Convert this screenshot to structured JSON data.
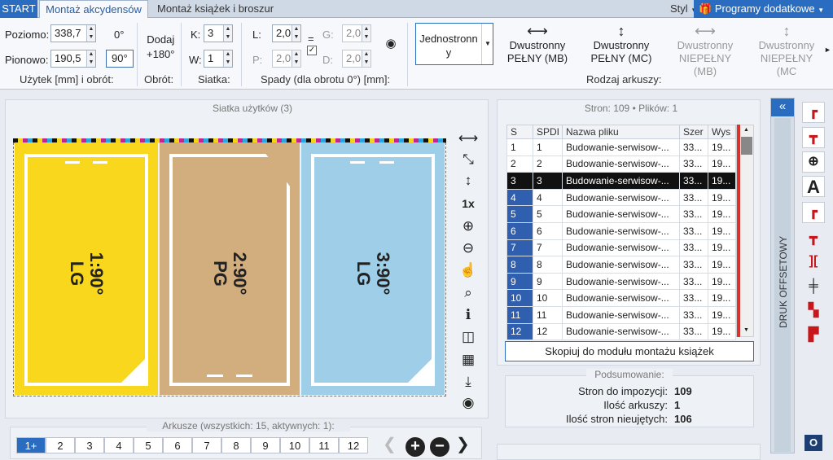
{
  "tabs": {
    "start": "START",
    "active": "Montaż akcydensów",
    "books": "Montaż książek i broszur",
    "style": "Styl",
    "addons": "Programy dodatkowe"
  },
  "ribbon": {
    "horizontal_label": "Poziomo:",
    "horizontal_value": "338,7",
    "vertical_label": "Pionowo:",
    "vertical_value": "190,5",
    "rot0": "0°",
    "rot90": "90°",
    "group_usage": "Użytek [mm] i obrót:",
    "add180_line1": "Dodaj",
    "add180_line2": "+180°",
    "group_rotation": "Obrót:",
    "k_label": "K:",
    "k_value": "3",
    "w_label": "W:",
    "w_value": "1",
    "group_grid": "Siatka:",
    "l_label": "L:",
    "l_value": "2,0",
    "p_label": "P:",
    "p_value": "2,0",
    "g_label": "G:",
    "g_value": "2,0",
    "d_label": "D:",
    "d_value": "2,0",
    "equals": "=",
    "group_bleed": "Spady (dla obrotu 0°) [mm]:",
    "one_sided_line1": "Jednostronn",
    "one_sided_line2": "y",
    "duplex_full_mb_1": "Dwustronny",
    "duplex_full_mb_2": "PEŁNY (MB)",
    "duplex_full_mc_1": "Dwustronny",
    "duplex_full_mc_2": "PEŁNY (MC)",
    "duplex_part_mb_1": "Dwustronny",
    "duplex_part_mb_2": "NIEPEŁNY (MB)",
    "duplex_part_mc_1": "Dwustronny",
    "duplex_part_mc_2": "NIEPEŁNY (MC",
    "group_sheet_type": "Rodzaj arkuszy:"
  },
  "grid_panel": {
    "title": "Siatka użytków (3)",
    "tiles": [
      {
        "line1": "1:90°",
        "line2": "LG",
        "color": "#f9d71c"
      },
      {
        "line1": "2:90°",
        "line2": "PG",
        "color": "#d2ad7e"
      },
      {
        "line1": "3:90°",
        "line2": "LG",
        "color": "#9fcfe8"
      }
    ],
    "zoom_label": "1x"
  },
  "files_panel": {
    "title": "Stron: 109 • Plików: 1",
    "columns": [
      "S",
      "SPDI",
      "Nazwa pliku",
      "Szer",
      "Wys"
    ],
    "rows": [
      [
        "1",
        "1",
        "Budowanie-serwisow-...",
        "33...",
        "19..."
      ],
      [
        "2",
        "2",
        "Budowanie-serwisow-...",
        "33...",
        "19..."
      ],
      [
        "3",
        "3",
        "Budowanie-serwisow-...",
        "33...",
        "19..."
      ],
      [
        "4",
        "4",
        "Budowanie-serwisow-...",
        "33...",
        "19..."
      ],
      [
        "5",
        "5",
        "Budowanie-serwisow-...",
        "33...",
        "19..."
      ],
      [
        "6",
        "6",
        "Budowanie-serwisow-...",
        "33...",
        "19..."
      ],
      [
        "7",
        "7",
        "Budowanie-serwisow-...",
        "33...",
        "19..."
      ],
      [
        "8",
        "8",
        "Budowanie-serwisow-...",
        "33...",
        "19..."
      ],
      [
        "9",
        "9",
        "Budowanie-serwisow-...",
        "33...",
        "19..."
      ],
      [
        "10",
        "10",
        "Budowanie-serwisow-...",
        "33...",
        "19..."
      ],
      [
        "11",
        "11",
        "Budowanie-serwisow-...",
        "33...",
        "19..."
      ],
      [
        "12",
        "12",
        "Budowanie-serwisow-...",
        "33...",
        "19..."
      ]
    ],
    "selected_row": 3,
    "copy_button": "Skopiuj do modułu montażu książek"
  },
  "summary": {
    "title": "Podsumowanie:",
    "pages_label": "Stron do impozycji:",
    "pages_value": "109",
    "sheets_label": "Ilość arkuszy:",
    "sheets_value": "1",
    "unused_label": "Ilość stron nieujętych:",
    "unused_value": "106"
  },
  "sheets_panel": {
    "title": "Arkusze (wszystkich: 15, aktywnych: 1):",
    "items": [
      "1+",
      "2",
      "3",
      "4",
      "5",
      "6",
      "7",
      "8",
      "9",
      "10",
      "11",
      "12"
    ]
  },
  "side_panel": {
    "vertical_label": "DRUK OFFSETOWY",
    "collapse": "«",
    "bottom_button": "O"
  },
  "colors": {
    "accent": "#2a6cbf",
    "selection": "#2f5fae",
    "mark_red": "#c8161d"
  }
}
